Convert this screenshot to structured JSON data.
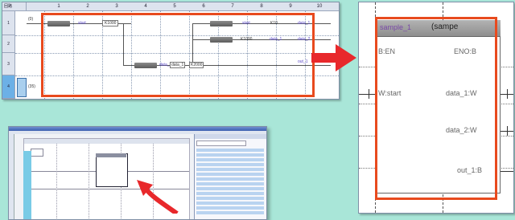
{
  "ladder": {
    "corner_label": "回路",
    "columns": [
      "1",
      "2",
      "3",
      "4",
      "5",
      "6",
      "7",
      "8",
      "9",
      "10"
    ],
    "rows": [
      {
        "num": "1",
        "step": "(0)"
      },
      {
        "num": "2",
        "step": ""
      },
      {
        "num": "3",
        "step": ""
      },
      {
        "num": "4",
        "step": "(35)"
      }
    ],
    "labels": {
      "start1": "start",
      "k1000a": "K1000",
      "start2": "start",
      "k10": "K10",
      "data1a": "data_1",
      "k1000b": "K1000",
      "data1b": "data_1",
      "data2": "data_2",
      "data3": "data_3",
      "stat": "data_1",
      "k2000": "K2000",
      "out1": "out_1"
    }
  },
  "zoom": {
    "fb_title": "sample_1",
    "fb_type": "(sampe",
    "en_in": "B:EN",
    "eno_out": "ENO:B",
    "start_in": "W:start",
    "data1_out": "data_1:W",
    "data2_out": "data_2:W",
    "out1_out": "out_1:B"
  },
  "colors": {
    "background": "#a9e6d8",
    "highlight": "#e84a1e",
    "arrow": "#e8282b",
    "device_label": "#5b48c9"
  },
  "icons": {
    "arrow_big": "right-arrow-icon",
    "arrow_small": "curved-arrow-icon"
  }
}
